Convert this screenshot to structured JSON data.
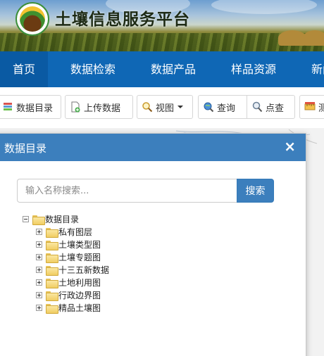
{
  "header": {
    "title": "土壤信息服务平台"
  },
  "nav": {
    "items": [
      {
        "label": "首页"
      },
      {
        "label": "数据检索"
      },
      {
        "label": "数据产品"
      },
      {
        "label": "样品资源"
      },
      {
        "label": "新闻"
      }
    ]
  },
  "toolbar": {
    "catalog_label": "数据目录",
    "upload_label": "上传数据",
    "view_label": "视图",
    "query_label": "查询",
    "point_query_label": "点查",
    "measure_label": "测"
  },
  "panel": {
    "title": "数据目录",
    "close_glyph": "×",
    "search_placeholder": "输入名称搜索...",
    "search_button": "搜索",
    "tree": {
      "root": "数据目录",
      "children": [
        {
          "label": "私有图层"
        },
        {
          "label": "土壤类型图"
        },
        {
          "label": "土壤专题图"
        },
        {
          "label": "十三五新数据"
        },
        {
          "label": "土地利用图"
        },
        {
          "label": "行政边界图"
        },
        {
          "label": "精品土壤图"
        }
      ]
    }
  }
}
